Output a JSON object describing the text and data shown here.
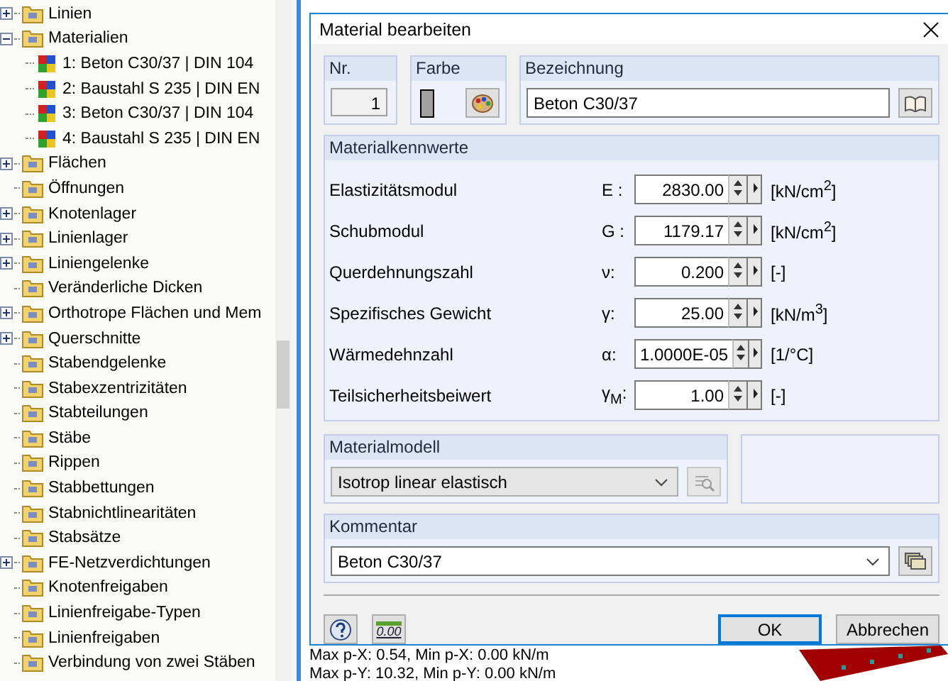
{
  "tree": {
    "items": [
      {
        "label": "Linien",
        "expanded": false
      },
      {
        "label": "Materialien",
        "expanded": true,
        "children": [
          {
            "label": "1: Beton C30/37 | DIN 104"
          },
          {
            "label": "2: Baustahl S 235 | DIN EN"
          },
          {
            "label": "3: Beton C30/37 | DIN 104"
          },
          {
            "label": "4: Baustahl S 235 | DIN EN"
          }
        ]
      },
      {
        "label": "Flächen",
        "expanded": false
      },
      {
        "label": "Öffnungen"
      },
      {
        "label": "Knotenlager",
        "expanded": false
      },
      {
        "label": "Linienlager",
        "expanded": false
      },
      {
        "label": "Liniengelenke",
        "expanded": false
      },
      {
        "label": "Veränderliche Dicken"
      },
      {
        "label": "Orthotrope Flächen und Mem",
        "expanded": false
      },
      {
        "label": "Querschnitte",
        "expanded": false
      },
      {
        "label": "Stabendgelenke"
      },
      {
        "label": "Stabexzentrizitäten"
      },
      {
        "label": "Stabteilungen"
      },
      {
        "label": "Stäbe"
      },
      {
        "label": "Rippen"
      },
      {
        "label": "Stabbettungen"
      },
      {
        "label": "Stabnichtlinearitäten"
      },
      {
        "label": "Stabsätze"
      },
      {
        "label": "FE-Netzverdichtungen",
        "expanded": false
      },
      {
        "label": "Knotenfreigaben"
      },
      {
        "label": "Linienfreigabe-Typen"
      },
      {
        "label": "Linienfreigaben"
      },
      {
        "label": "Verbindung von zwei Stäben"
      }
    ]
  },
  "dialog": {
    "title": "Material bearbeiten",
    "number": {
      "label": "Nr.",
      "value": "1"
    },
    "swatch": {
      "label": "Farbe",
      "color": "#a0a0a0"
    },
    "name": {
      "label": "Bezeichnung",
      "value": "Beton C30/37"
    },
    "properties": {
      "title": "Materialkennwerte",
      "rows": [
        {
          "label": "Elastizitätsmodul",
          "symbol": "E :",
          "value": "2830.00",
          "unit": "[kN/cm$^{2}$]"
        },
        {
          "label": "Schubmodul",
          "symbol": "G :",
          "value": "1179.17",
          "unit": "[kN/cm$^{2}$]"
        },
        {
          "label": "Querdehnungszahl",
          "symbol": "ν:",
          "value": "0.200",
          "unit": "[-]"
        },
        {
          "label": "Spezifisches Gewicht",
          "symbol": "γ:",
          "value": "25.00",
          "unit": "[kN/m$^{3}$]"
        },
        {
          "label": "Wärmedehnzahl",
          "symbol": "α:",
          "value": "1.0000E-05",
          "unit": "[1/°C]"
        },
        {
          "label": "Teilsicherheitsbeiwert",
          "symbol": "γ$_{M}$:",
          "value": "1.00",
          "unit": "[-]"
        }
      ]
    },
    "model": {
      "title": "Materialmodell",
      "value": "Isotrop linear elastisch"
    },
    "comment": {
      "title": "Kommentar",
      "value": "Beton C30/37"
    },
    "decimals_button": {
      "label": "0.00"
    },
    "buttons": [
      {
        "label": "OK",
        "default": true
      },
      {
        "label": "Abbrechen",
        "default": false
      }
    ]
  },
  "status_lines": [
    "Max p-X: 0.54, Min p-X: 0.00 kN/m",
    "Max p-Y: 10.32, Min p-Y: 0.00 kN/m"
  ]
}
